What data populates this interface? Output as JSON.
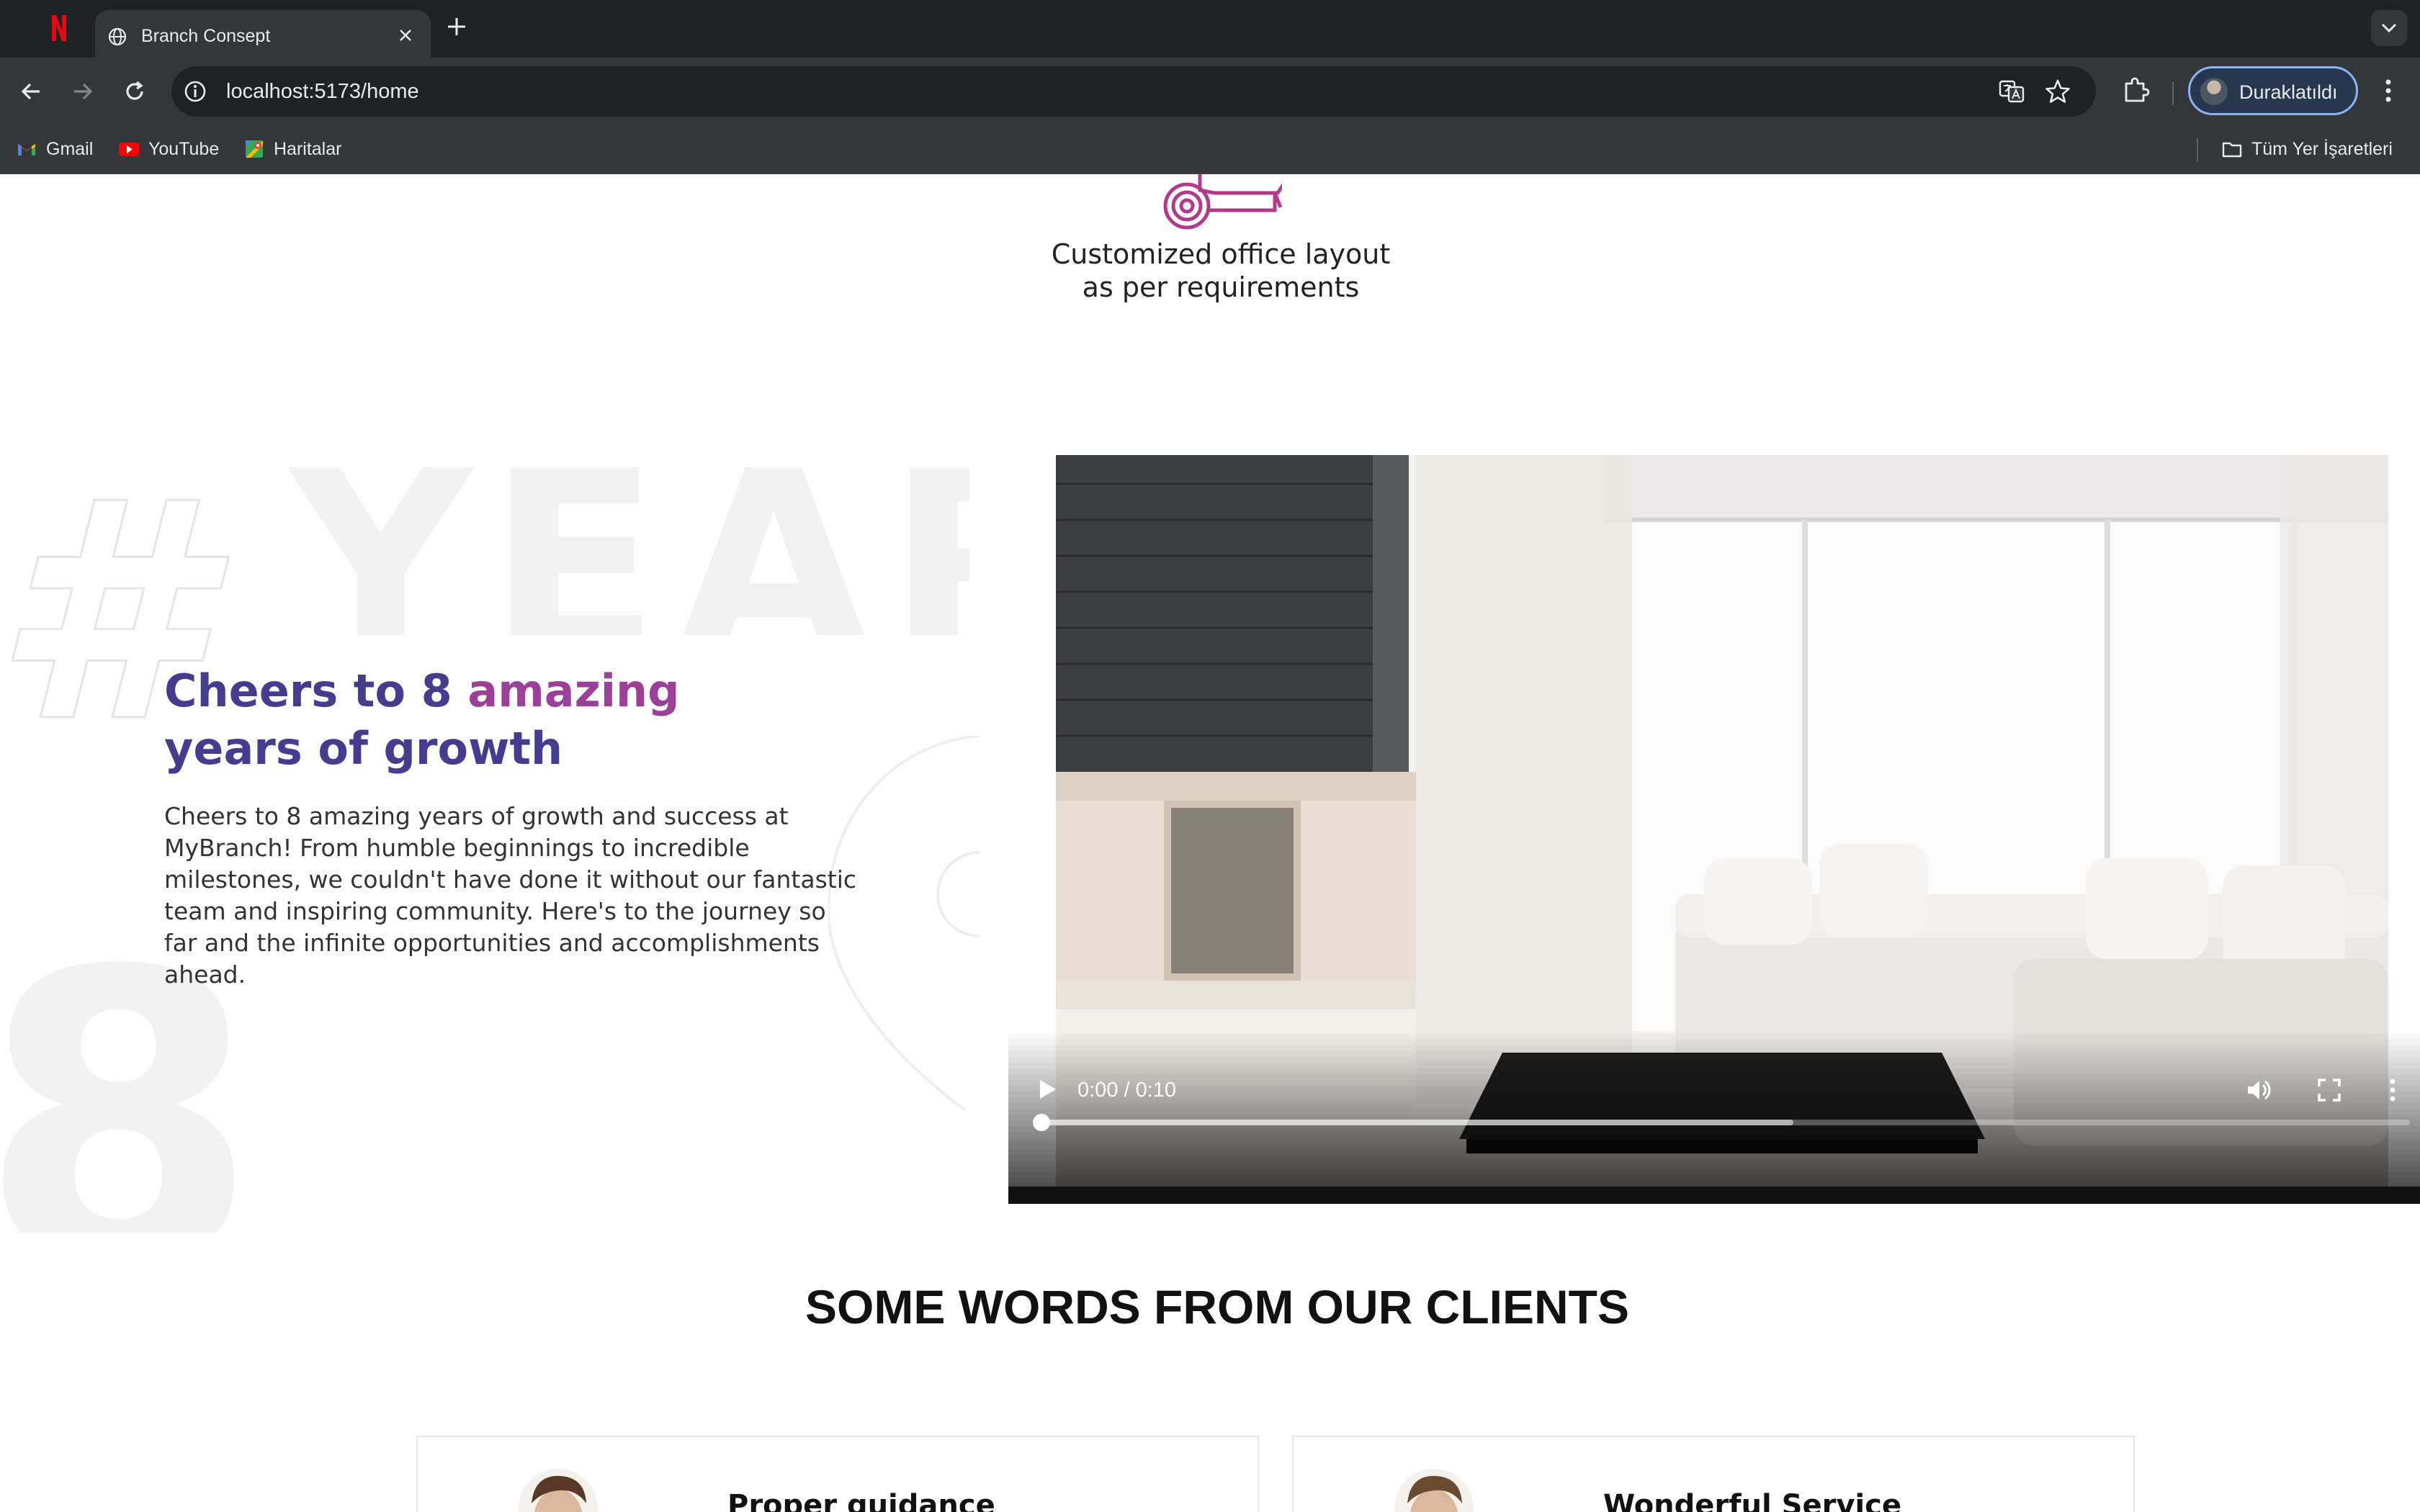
{
  "browser": {
    "tabs": [
      {
        "title": "Branch Consept",
        "active": true
      }
    ],
    "address_bar": {
      "url": "localhost:5173/home"
    },
    "profile": {
      "label": "Duraklatıldı"
    },
    "bookmarks": [
      {
        "label": "Gmail",
        "icon": "gmail-icon"
      },
      {
        "label": "YouTube",
        "icon": "youtube-icon"
      },
      {
        "label": "Haritalar",
        "icon": "maps-icon"
      }
    ],
    "all_bookmarks_label": "Tüm Yer İşaretleri"
  },
  "page": {
    "service": {
      "icon": "office-layout-icon",
      "caption_line1": "Customized office layout",
      "caption_line2": "as per requirements"
    },
    "background_words": {
      "year": "YEAR",
      "hash": "#",
      "eight": "8"
    },
    "growth": {
      "title_part1": "Cheers to 8 ",
      "title_accent": "amazing",
      "title_part2": "years of growth",
      "paragraph": "Cheers to 8 amazing years of growth and success at MyBranch! From humble beginnings to incredible milestones, we couldn't have done it without our fantastic team and inspiring community. Here's to the journey so far and the infinite opportunities and accomplishments ahead."
    },
    "video": {
      "time_display": "0:00 / 0:10",
      "current_seconds": 0,
      "duration_seconds": 10,
      "buffered_fraction": 0.55
    },
    "clients": {
      "heading_normal": "SOME WORDS FROM ",
      "heading_bold": "OUR CLIENTS",
      "cards": [
        {
          "title": "Proper guidance"
        },
        {
          "title": "Wonderful Service"
        }
      ]
    }
  },
  "colors": {
    "brand_purple": "#463c8f",
    "brand_magenta": "#9b3f98",
    "icon_pink": "#b03a8c",
    "chrome_dark": "#202124",
    "chrome_mid": "#35363a"
  }
}
